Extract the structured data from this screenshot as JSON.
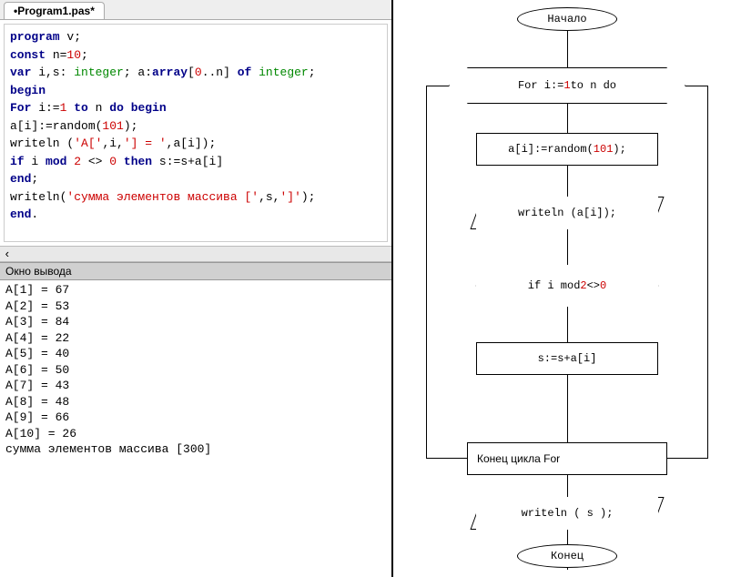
{
  "tab": {
    "title": "•Program1.pas*"
  },
  "code": {
    "l1a": "program",
    "l1b": " v;",
    "l2a": "const",
    "l2b": " n=",
    "l2n": "10",
    "l2c": ";",
    "l3a": "var",
    "l3b": " i,s: ",
    "l3t1": "integer",
    "l3c": "; a:",
    "l3t2": "array",
    "l3d": "[",
    "l3n1": "0",
    "l3e": "..n] ",
    "l3of": "of",
    "l3f": " ",
    "l3t3": "integer",
    "l3g": ";",
    "l4": "begin",
    "l5a": "For",
    "l5b": " i:=",
    "l5n": "1",
    "l5c": " ",
    "l5to": "to",
    "l5d": " n ",
    "l5do": "do",
    "l5e": " ",
    "l5bg": "begin",
    "l6a": "a[i]:=random(",
    "l6n": "101",
    "l6b": ");",
    "l7a": "writeln (",
    "l7s1": "'A['",
    "l7b": ",i,",
    "l7s2": "'] = '",
    "l7c": ",a[i]);",
    "l8a": "if",
    "l8b": " i ",
    "l8mod": "mod",
    "l8c": " ",
    "l8n1": "2",
    "l8d": " <> ",
    "l8n2": "0",
    "l8e": " ",
    "l8then": "then",
    "l8f": " s:=s+a[i]",
    "l9": "end",
    "l9b": ";",
    "l10a": "writeln(",
    "l10s1": "'сумма элементов массива ['",
    "l10b": ",s,",
    "l10s2": "']'",
    "l10c": ");",
    "l11": "end",
    "l11b": "."
  },
  "scroll_chevron": "‹",
  "output_header": "Окно вывода",
  "output": {
    "lines": [
      "A[1] = 67",
      "A[2] = 53",
      "A[3] = 84",
      "A[4] = 22",
      "A[5] = 40",
      "A[6] = 50",
      "A[7] = 43",
      "A[8] = 48",
      "A[9] = 66",
      "A[10] = 26",
      "сумма элементов массива [300]"
    ]
  },
  "flow": {
    "start": "Начало",
    "for": {
      "t1": "For i:=",
      "n1": "1",
      "t2": " to n do"
    },
    "assign": {
      "t1": "a[i]:=random(",
      "n1": "101",
      "t2": ");"
    },
    "write1": "writeln (a[i]);",
    "cond": {
      "t1": "if i mod ",
      "n1": "2",
      "t2": " <> ",
      "n2": "0"
    },
    "sum": "s:=s+a[i]",
    "endfor": "Конец цикла For",
    "write2": "writeln ( s );",
    "end": "Конец"
  }
}
